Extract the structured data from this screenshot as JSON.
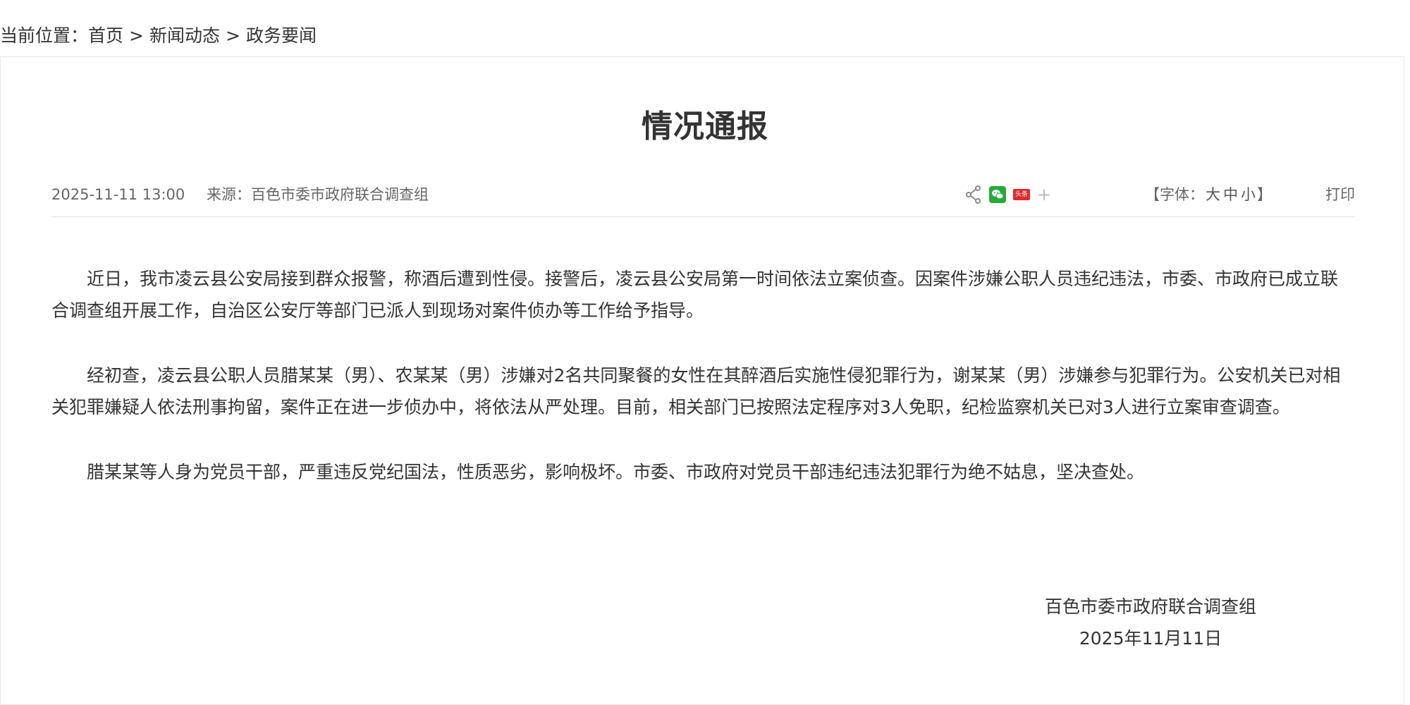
{
  "breadcrumb": {
    "prefix": "当前位置：",
    "items": [
      "首页",
      "新闻动态",
      "政务要闻"
    ],
    "separator": ">"
  },
  "article": {
    "title": "情况通报",
    "date": "2025-11-11 13:00",
    "source": "来源：百色市委市政府联合调查组",
    "font_size": {
      "open": "【字体：",
      "large": "大",
      "medium": "中",
      "small": "小",
      "close": "】"
    },
    "print": "打印",
    "paragraphs": [
      "近日，我市凌云县公安局接到群众报警，称酒后遭到性侵。接警后，凌云县公安局第一时间依法立案侦查。因案件涉嫌公职人员违纪违法，市委、市政府已成立联合调查组开展工作，自治区公安厅等部门已派人到现场对案件侦办等工作给予指导。",
      "经初查，凌云县公职人员腊某某（男）、农某某（男）涉嫌对2名共同聚餐的女性在其醉酒后实施性侵犯罪行为，谢某某（男）涉嫌参与犯罪行为。公安机关已对相关犯罪嫌疑人依法刑事拘留，案件正在进一步侦办中，将依法从严处理。目前，相关部门已按照法定程序对3人免职，纪检监察机关已对3人进行立案审查调查。",
      "腊某某等人身为党员干部，严重违反党纪国法，性质恶劣，影响极坏。市委、市政府对党员干部违纪违法犯罪行为绝不姑息，坚决查处。"
    ],
    "signature": {
      "org": "百色市委市政府联合调查组",
      "date": "2025年11月11日"
    }
  },
  "share": {
    "icons": [
      "share-icon",
      "wechat-icon",
      "toutiao-icon",
      "plus-icon"
    ],
    "toutiao_label": "头条",
    "plus_label": "+",
    "colors": {
      "wechat": "#22ac38",
      "toutiao": "#e02b2b"
    }
  }
}
